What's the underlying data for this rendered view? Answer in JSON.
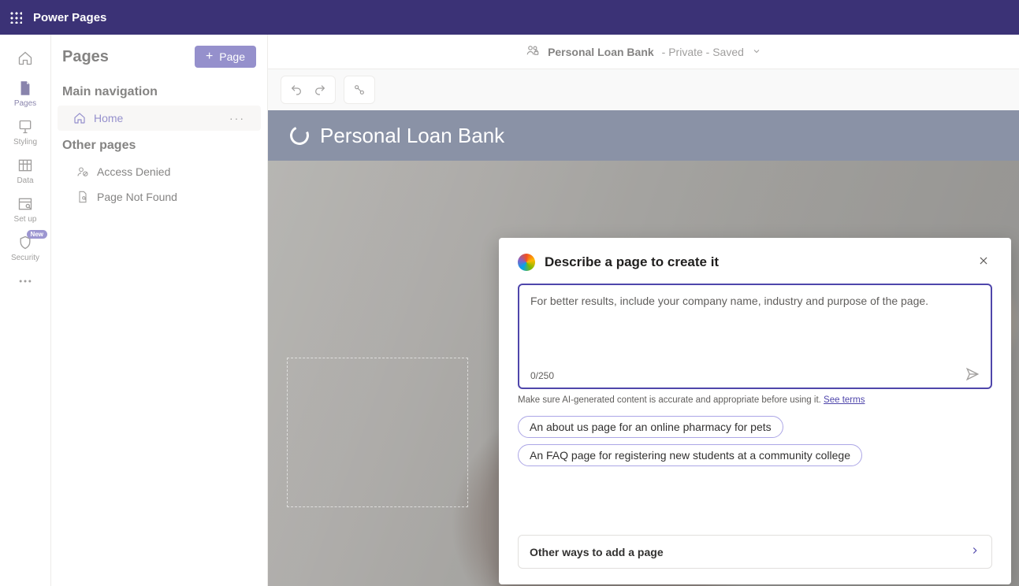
{
  "app": {
    "title": "Power Pages"
  },
  "rail": {
    "home": "",
    "items": [
      {
        "label": "Pages"
      },
      {
        "label": "Styling"
      },
      {
        "label": "Data"
      },
      {
        "label": "Set up"
      },
      {
        "label": "Security",
        "badge": "New"
      }
    ]
  },
  "sidepanel": {
    "title": "Pages",
    "add_button": "Page",
    "sections": {
      "main_nav_label": "Main navigation",
      "other_label": "Other pages",
      "home_label": "Home",
      "items": [
        {
          "label": "Access Denied"
        },
        {
          "label": "Page Not Found"
        }
      ]
    }
  },
  "statusbar": {
    "site_name": "Personal Loan Bank",
    "state": " - Private - Saved"
  },
  "banner": {
    "title": "Personal Loan Bank"
  },
  "dialog": {
    "title": "Describe a page to create it",
    "placeholder": "For better results, include your company name, industry and purpose of the page.",
    "counter": "0/250",
    "disclaimer_prefix": "Make sure AI-generated content is accurate and appropriate before using it. ",
    "disclaimer_link": "See terms",
    "suggestions": [
      "An about us page for an online pharmacy for pets",
      "An FAQ page for registering new students at a community college"
    ],
    "other_ways": "Other ways to add a page"
  }
}
